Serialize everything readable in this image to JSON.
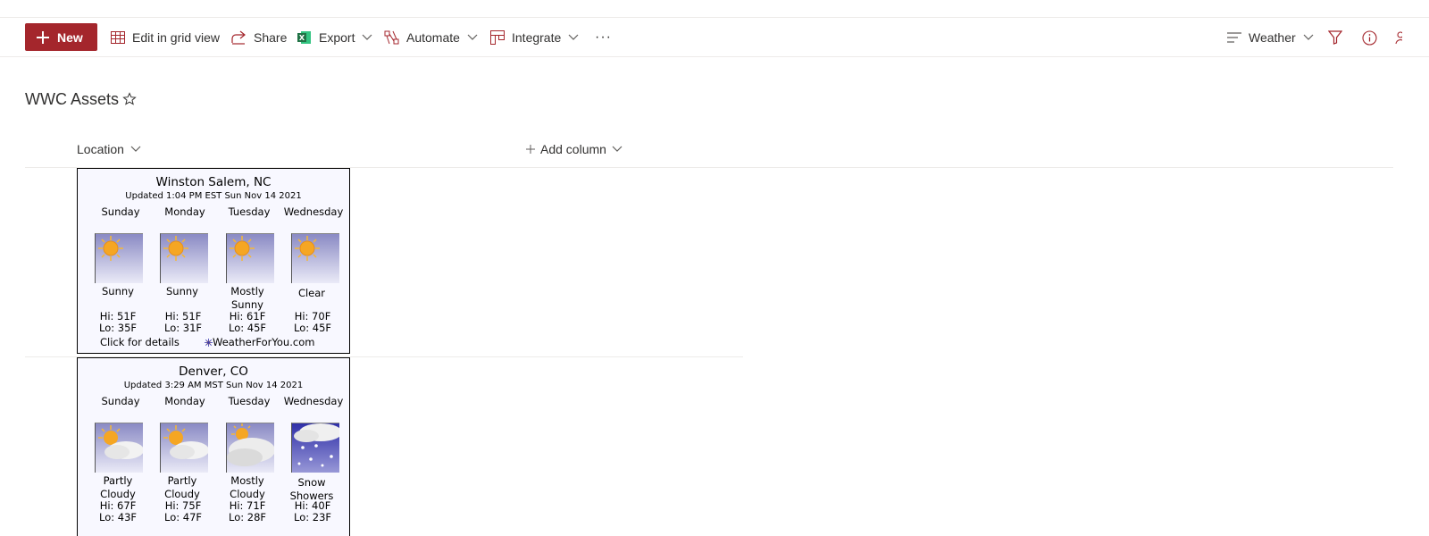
{
  "toolbar": {
    "new_label": "New",
    "edit_grid_label": "Edit in grid view",
    "share_label": "Share",
    "export_label": "Export",
    "automate_label": "Automate",
    "integrate_label": "Integrate",
    "more_label": "···",
    "view_label": "Weather"
  },
  "colors": {
    "brand_red": "#a4262c",
    "excel_green": "#217346",
    "weather_sky": "#8a8ac4"
  },
  "page": {
    "title": "WWC Assets"
  },
  "columns": {
    "location": "Location",
    "add_column": "Add column"
  },
  "rows": [
    {
      "city": "Winston Salem, NC",
      "updated": "Updated 1:04 PM EST Sun Nov 14 2021",
      "days": [
        {
          "day": "Sunday",
          "icon": "sunny-icon",
          "cond": "Sunny",
          "hi": "Hi: 51F",
          "lo": "Lo: 35F"
        },
        {
          "day": "Monday",
          "icon": "sunny-icon",
          "cond": "Sunny",
          "hi": "Hi: 51F",
          "lo": "Lo: 31F"
        },
        {
          "day": "Tuesday",
          "icon": "sunny-icon",
          "cond": "Mostly Sunny",
          "hi": "Hi: 61F",
          "lo": "Lo: 45F"
        },
        {
          "day": "Wednesday",
          "icon": "clear-icon",
          "cond": "Clear",
          "hi": "Hi: 70F",
          "lo": "Lo: 45F"
        }
      ],
      "footer_left": "Click for details",
      "footer_right": "WeatherForYou.com"
    },
    {
      "city": "Denver, CO",
      "updated": "Updated 3:29 AM MST Sun Nov 14 2021",
      "days": [
        {
          "day": "Sunday",
          "icon": "partly-cloudy-icon",
          "cond": "Partly Cloudy",
          "hi": "Hi: 67F",
          "lo": "Lo: 43F"
        },
        {
          "day": "Monday",
          "icon": "partly-cloudy-icon",
          "cond": "Partly Cloudy",
          "hi": "Hi: 75F",
          "lo": "Lo: 47F"
        },
        {
          "day": "Tuesday",
          "icon": "mostly-cloudy-icon",
          "cond": "Mostly Cloudy",
          "hi": "Hi: 71F",
          "lo": "Lo: 28F"
        },
        {
          "day": "Wednesday",
          "icon": "snow-showers-icon",
          "cond": "Snow Showers",
          "hi": "Hi: 40F",
          "lo": "Lo: 23F"
        }
      ]
    }
  ]
}
